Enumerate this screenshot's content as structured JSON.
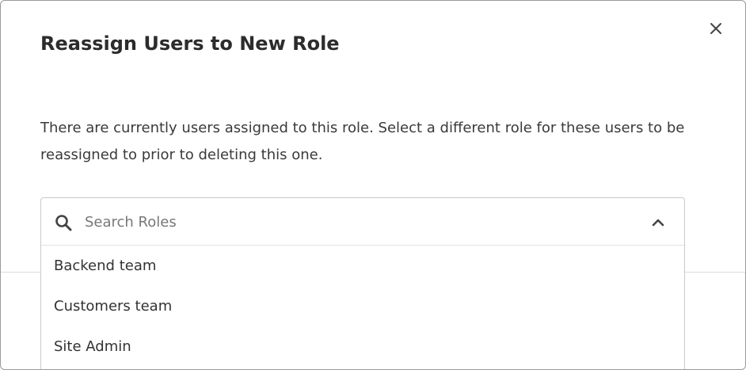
{
  "modal": {
    "title": "Reassign Users to New Role",
    "description": "There are currently users assigned to this role. Select a different role for these users to be reassigned to prior to deleting this one.",
    "close_icon": "close-icon"
  },
  "role_select": {
    "placeholder": "Search Roles",
    "value": "",
    "search_icon": "search-icon",
    "toggle_icon": "chevron-up-icon",
    "expanded": true,
    "options": [
      {
        "label": "Backend team"
      },
      {
        "label": "Customers team"
      },
      {
        "label": "Site Admin"
      }
    ]
  },
  "colors": {
    "text": "#2c2c2c",
    "border": "#c9c9c9",
    "icon": "#444444"
  }
}
